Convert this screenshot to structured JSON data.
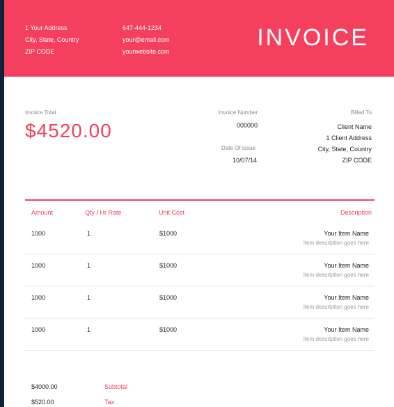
{
  "header": {
    "title": "INVOICE",
    "address_lines": [
      "1 Your Address",
      "City, State, Country",
      "ZIP CODE"
    ],
    "contact_lines": [
      "647-444-1234",
      "your@email.com",
      "yourwebsite.com"
    ]
  },
  "summary": {
    "invoice_total_label": "Invoice Total",
    "invoice_total": "$4520.00",
    "invoice_number_label": "Invoice Number",
    "invoice_number": "000000",
    "date_label": "Date Of Issue",
    "date": "10/07/14",
    "billed_to_label": "Billed To",
    "billed_to_lines": [
      "Client Name",
      "1 Client Address",
      "City, State, Country",
      "ZIP CODE"
    ]
  },
  "table": {
    "headers": {
      "amount": "Amount",
      "qty": "Qty / Hr Rate",
      "unit_cost": "Unit Cost",
      "description": "Description"
    },
    "rows": [
      {
        "amount": "1000",
        "qty": "1",
        "unit_cost": "$1000",
        "name": "Your Item Name",
        "desc": "Item description goes here"
      },
      {
        "amount": "1000",
        "qty": "1",
        "unit_cost": "$1000",
        "name": "Your Item Name",
        "desc": "Item description goes here"
      },
      {
        "amount": "1000",
        "qty": "1",
        "unit_cost": "$1000",
        "name": "Your Item Name",
        "desc": "Item description goes here"
      },
      {
        "amount": "1000",
        "qty": "1",
        "unit_cost": "$1000",
        "name": "Your Item Name",
        "desc": "Item description goes here"
      }
    ]
  },
  "totals": {
    "subtotal_label": "Subtotal",
    "subtotal": "$4000.00",
    "tax_label": "Tax",
    "tax": "$520.00"
  },
  "colors": {
    "accent": "#f43f5e",
    "sidebar": "#0f2338"
  }
}
